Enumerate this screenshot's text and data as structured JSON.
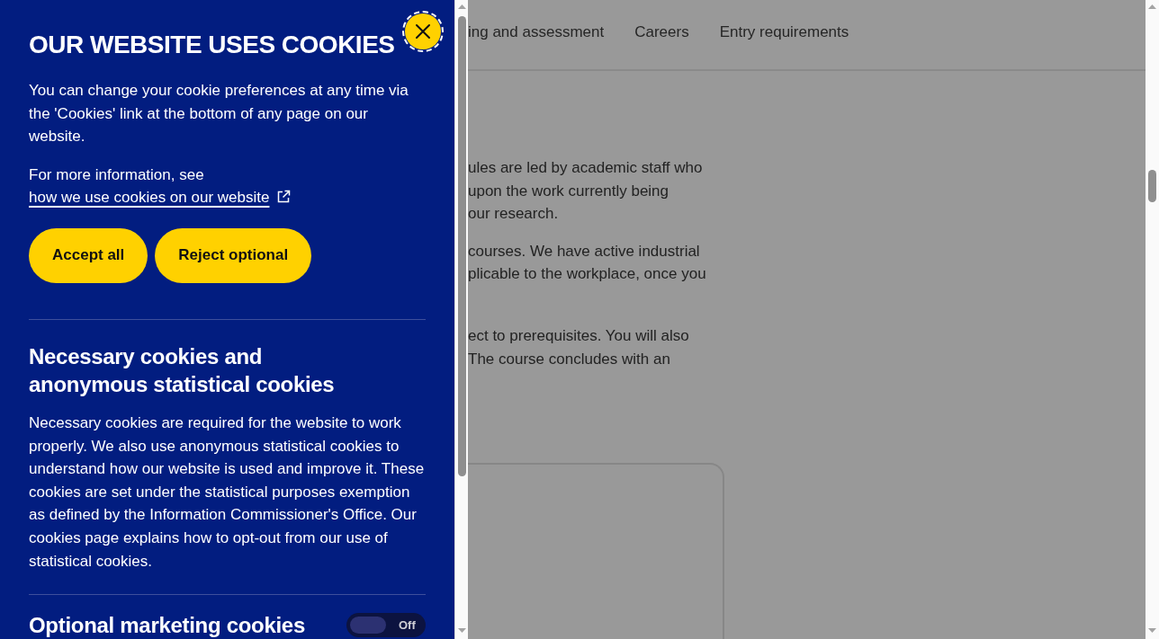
{
  "cookie_panel": {
    "title": "OUR WEBSITE USES COOKIES",
    "close_button": {
      "focused": true
    },
    "intro": "You can change your cookie preferences at any time via the 'Cookies' link at the bottom of any page on our website.",
    "more_info": {
      "text": "For more information, see",
      "link": "how we use cookies on our website"
    },
    "buttons": [
      {
        "label": "Accept all"
      },
      {
        "label": "Reject optional"
      }
    ],
    "sections": [
      {
        "heading": "Necessary cookies and anonymous statistical cookies",
        "description": "Necessary cookies are required for the website to work properly. We also use anonymous statistical cookies to understand how our website is used and improve it. These cookies are set under the statistical purposes exemption as defined by the Information Commissioner's Office. Our cookies page explains how to opt-out from our use of statistical cookies."
      },
      {
        "heading": "Optional marketing cookies",
        "toggle": {
          "on": false,
          "label": "Off"
        }
      }
    ]
  },
  "page": {
    "nav": [
      {
        "label": "ing and assessment"
      },
      {
        "label": "Careers"
      },
      {
        "label": "Entry requirements"
      }
    ],
    "paragraphs": [
      {
        "lines": [
          "ules are led by academic staff who",
          "upon the work currently being",
          "our research."
        ]
      },
      {
        "lines": [
          "courses. We have active industrial",
          "plicable to the workplace, once you"
        ]
      },
      {
        "lines": [
          "ect to prerequisites. You will also",
          "The course concludes with an"
        ]
      }
    ]
  }
}
